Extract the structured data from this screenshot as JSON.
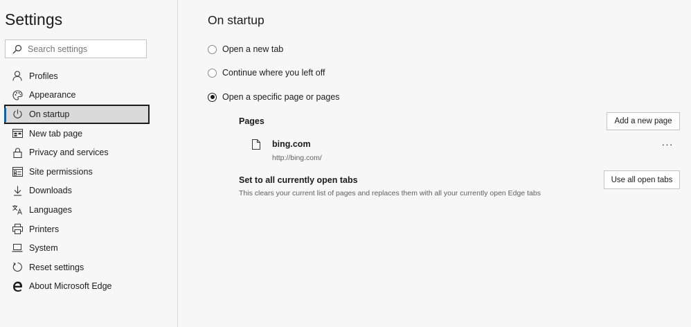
{
  "sidebar": {
    "title": "Settings",
    "search_placeholder": "Search settings",
    "items": [
      {
        "label": "Profiles",
        "icon": "person-icon"
      },
      {
        "label": "Appearance",
        "icon": "palette-icon"
      },
      {
        "label": "On startup",
        "icon": "power-icon",
        "active": true
      },
      {
        "label": "New tab page",
        "icon": "new-tab-icon"
      },
      {
        "label": "Privacy and services",
        "icon": "lock-icon"
      },
      {
        "label": "Site permissions",
        "icon": "site-permissions-icon"
      },
      {
        "label": "Downloads",
        "icon": "download-icon"
      },
      {
        "label": "Languages",
        "icon": "languages-icon"
      },
      {
        "label": "Printers",
        "icon": "printer-icon"
      },
      {
        "label": "System",
        "icon": "laptop-icon"
      },
      {
        "label": "Reset settings",
        "icon": "reset-icon"
      },
      {
        "label": "About Microsoft Edge",
        "icon": "edge-logo-icon"
      }
    ]
  },
  "main": {
    "title": "On startup",
    "options": [
      {
        "label": "Open a new tab",
        "checked": false
      },
      {
        "label": "Continue where you left off",
        "checked": false
      },
      {
        "label": "Open a specific page or pages",
        "checked": true
      }
    ],
    "pages_label": "Pages",
    "add_page_button": "Add a new page",
    "pages": [
      {
        "name": "bing.com",
        "url": "http://bing.com/"
      }
    ],
    "more_actions": "···",
    "set_open_tabs_title": "Set to all currently open tabs",
    "set_open_tabs_desc": "This clears your current list of pages and replaces them with all your currently open Edge tabs",
    "use_all_tabs_button": "Use all open tabs"
  },
  "colors": {
    "accent": "#0067b8",
    "background": "#f7f7f7",
    "active_item": "#dadada"
  }
}
